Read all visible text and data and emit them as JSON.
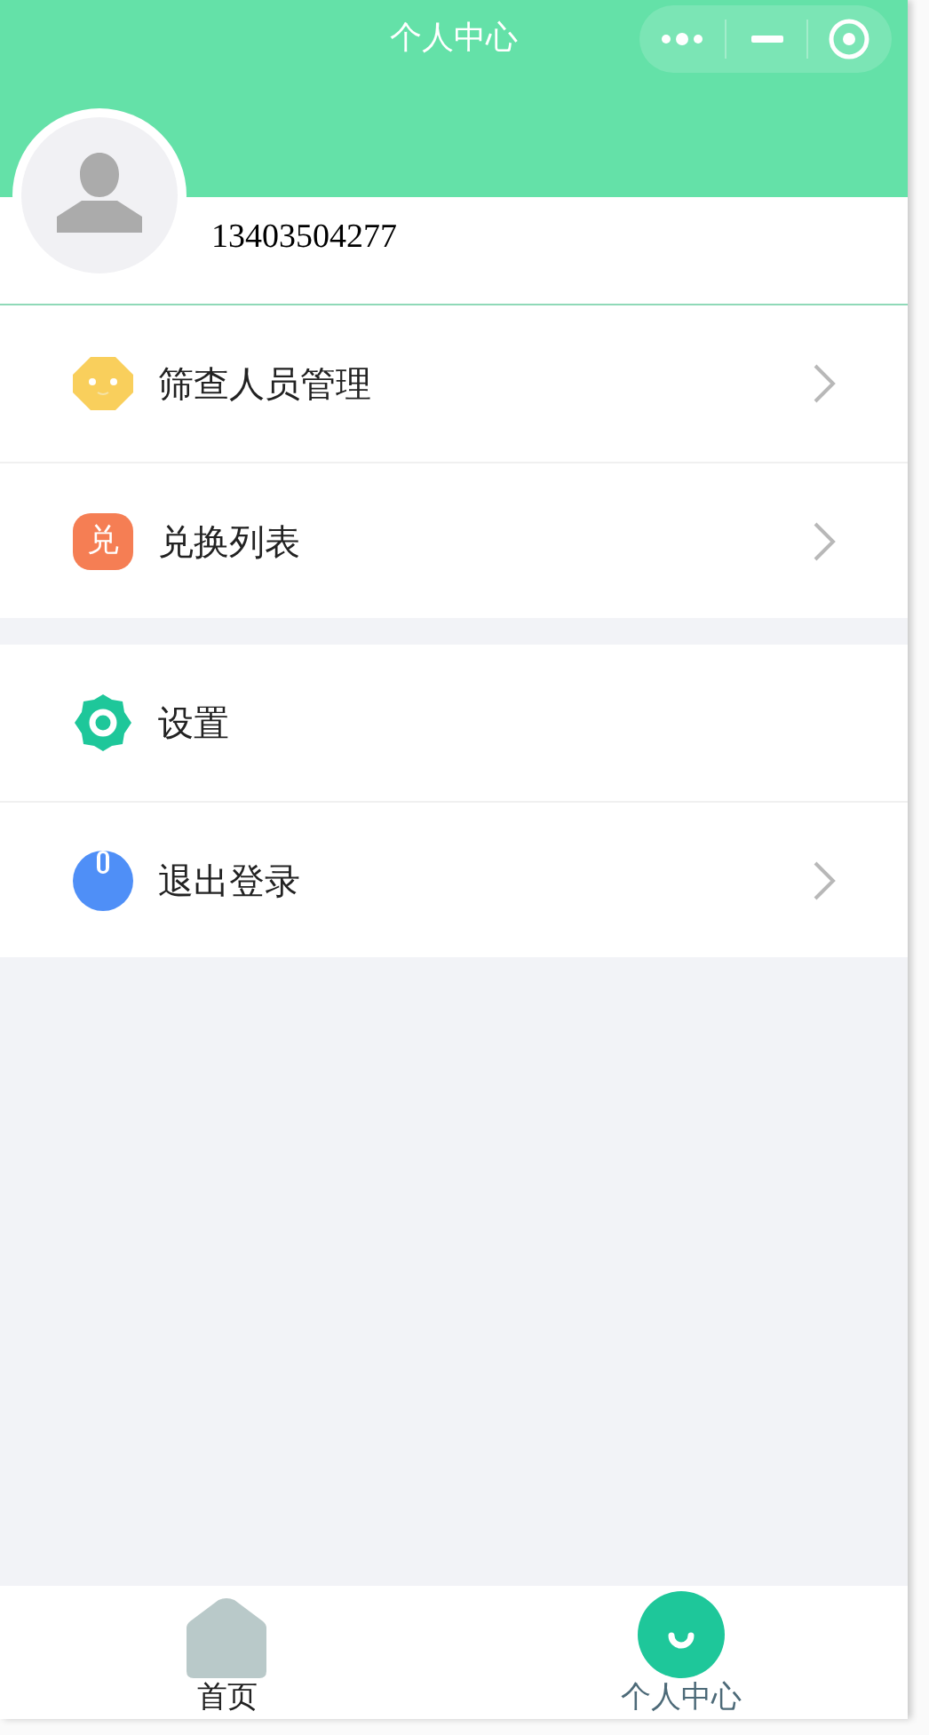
{
  "header": {
    "title": "个人中心"
  },
  "profile": {
    "phone": "13403504277"
  },
  "menu_groups": [
    {
      "items": [
        {
          "kind": "face",
          "label": "筛查人员管理",
          "chevron": true
        },
        {
          "kind": "exchange",
          "icon_text": "兑",
          "label": "兑换列表",
          "chevron": true
        }
      ]
    },
    {
      "items": [
        {
          "kind": "gear",
          "label": "设置",
          "chevron": false
        },
        {
          "kind": "power",
          "label": "退出登录",
          "chevron": true
        }
      ]
    }
  ],
  "tab_bar": [
    {
      "kind": "home",
      "label": "首页",
      "selected": false
    },
    {
      "kind": "profile",
      "label": "个人中心",
      "selected": true
    }
  ]
}
